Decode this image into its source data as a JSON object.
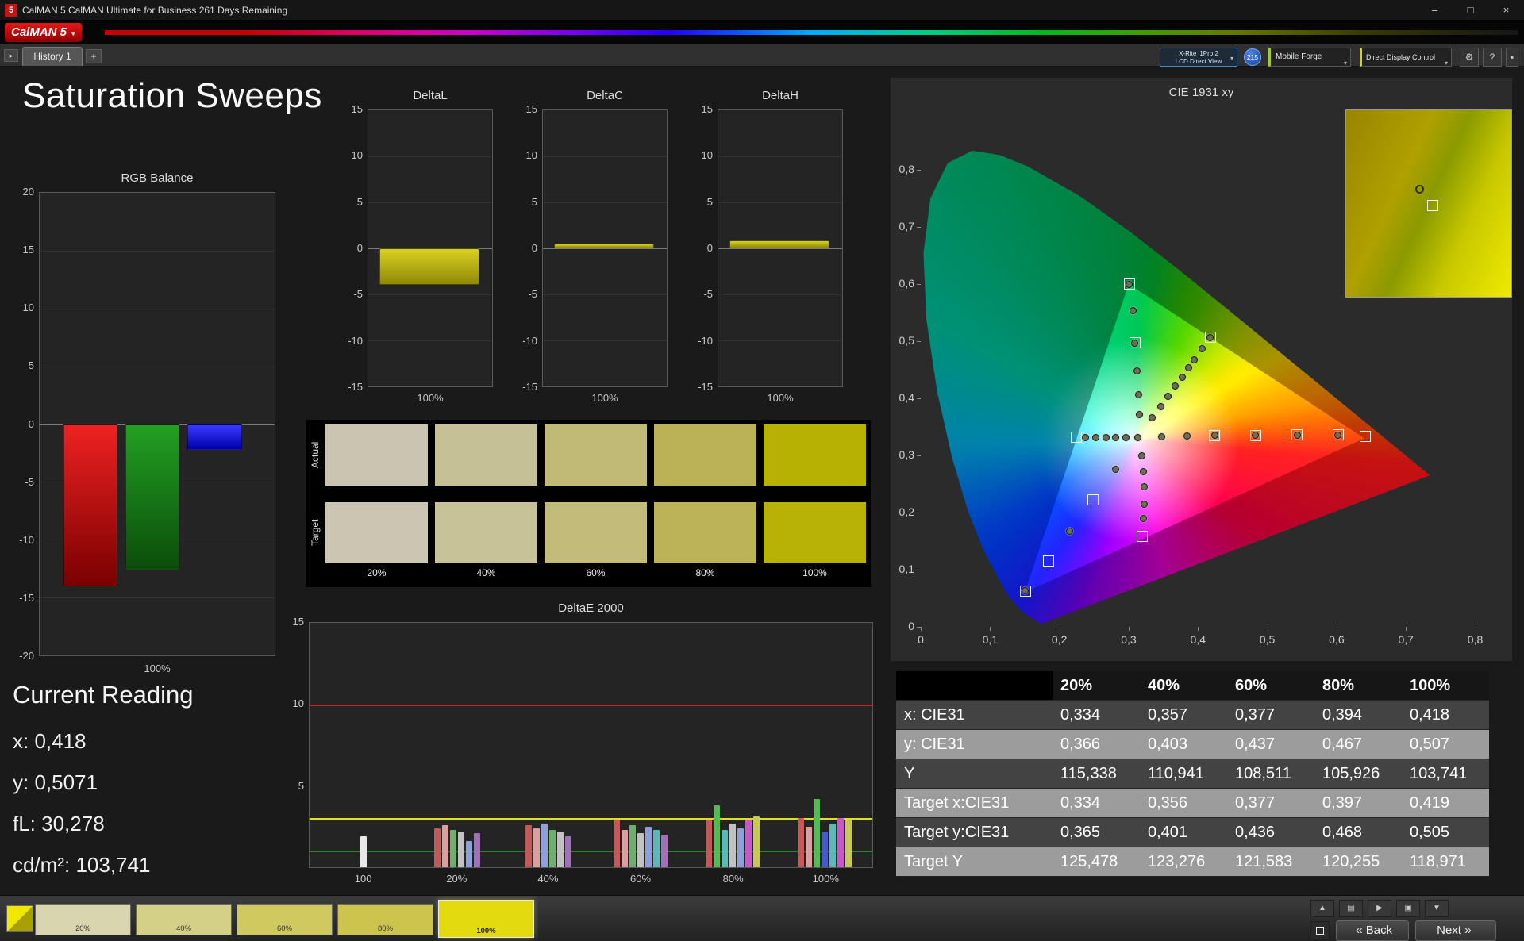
{
  "window": {
    "icon": "5",
    "title": "CalMAN 5 CalMAN Ultimate for Business 261 Days Remaining",
    "minimize": "–",
    "maximize": "□",
    "close": "×"
  },
  "icons": {
    "caret": "▾",
    "nav_arrow": "▸",
    "gear": "⚙",
    "help": "?",
    "pin": "▪",
    "chevron_left": "«",
    "chevron_right": "»"
  },
  "logo": {
    "text": "CalMAN 5"
  },
  "tabs": {
    "history": "History 1",
    "add": "+"
  },
  "meters": {
    "meter_line1": "X-Rite i1Pro 2",
    "meter_line2": "LCD Direct View",
    "badge": "215",
    "source": "Mobile Forge",
    "display_control": "Direct Display Control"
  },
  "page": {
    "title": "Saturation Sweeps"
  },
  "rgb_balance": {
    "title": "RGB Balance",
    "xlabel": "100%",
    "ylim": [
      -20,
      20
    ],
    "yticks": [
      "20",
      "15",
      "10",
      "5",
      "0",
      "-5",
      "-10",
      "-15",
      "-20"
    ],
    "bars": [
      {
        "name": "red",
        "value": -14.0,
        "c1": "#ee2222",
        "c2": "#7a0000"
      },
      {
        "name": "green",
        "value": -12.6,
        "c1": "#22a022",
        "c2": "#0b4d0b"
      },
      {
        "name": "blue",
        "value": -2.2,
        "c1": "#3a3aff",
        "c2": "#0000aa"
      }
    ]
  },
  "delta_axis": {
    "ylim": [
      -15,
      15
    ],
    "yticks": [
      "15",
      "10",
      "5",
      "0",
      "-5",
      "-10",
      "-15"
    ],
    "xlabel": "100%"
  },
  "delta_charts": [
    {
      "title": "DeltaL",
      "value": -4.0
    },
    {
      "title": "DeltaC",
      "value": 0.5
    },
    {
      "title": "DeltaH",
      "value": 0.9
    }
  ],
  "swatches": {
    "row_labels": [
      "Actual",
      "Target"
    ],
    "col_labels": [
      "20%",
      "40%",
      "60%",
      "80%",
      "100%"
    ],
    "actual": [
      "#c9c5b0",
      "#c6c195",
      "#c1ba77",
      "#bbb257",
      "#b7b104"
    ],
    "target": [
      "#cac6b1",
      "#c7c297",
      "#c2bb79",
      "#bcb359",
      "#b8b206"
    ]
  },
  "deltae": {
    "title": "DeltaE 2000",
    "ylim": [
      0,
      15
    ],
    "yticks": [
      "15",
      "10",
      "5"
    ],
    "ref_lines": [
      {
        "value": 10,
        "color": "#cc2222"
      },
      {
        "value": 3,
        "color": "#e0e020"
      },
      {
        "value": 1,
        "color": "#1e8c1e"
      }
    ],
    "groups": [
      {
        "label": "100",
        "x": 0.0965,
        "bars": [
          {
            "v": 1.9,
            "c": "#e8e8e8"
          }
        ]
      },
      {
        "label": "20%",
        "x": 0.262,
        "bars": [
          {
            "v": 2.4,
            "c": "#c25a5a"
          },
          {
            "v": 2.6,
            "c": "#daa0a0"
          },
          {
            "v": 2.3,
            "c": "#6fae6f"
          },
          {
            "v": 2.2,
            "c": "#c2c2c2"
          },
          {
            "v": 1.6,
            "c": "#8f9fd8"
          },
          {
            "v": 2.1,
            "c": "#a272b8"
          }
        ]
      },
      {
        "label": "40%",
        "x": 0.424,
        "bars": [
          {
            "v": 2.6,
            "c": "#c25a5a"
          },
          {
            "v": 2.4,
            "c": "#daa0a0"
          },
          {
            "v": 2.7,
            "c": "#8f9fd8"
          },
          {
            "v": 2.3,
            "c": "#6fae6f"
          },
          {
            "v": 2.2,
            "c": "#c2c2c2"
          },
          {
            "v": 1.9,
            "c": "#a272b8"
          }
        ]
      },
      {
        "label": "60%",
        "x": 0.588,
        "bars": [
          {
            "v": 2.9,
            "c": "#c25a5a"
          },
          {
            "v": 2.3,
            "c": "#daa0a0"
          },
          {
            "v": 2.6,
            "c": "#6fae6f"
          },
          {
            "v": 2.1,
            "c": "#c2c2c2"
          },
          {
            "v": 2.5,
            "c": "#8f9fd8"
          },
          {
            "v": 2.3,
            "c": "#5fb8b8"
          },
          {
            "v": 2.0,
            "c": "#a272b8"
          }
        ]
      },
      {
        "label": "80%",
        "x": 0.752,
        "bars": [
          {
            "v": 2.9,
            "c": "#c25a5a"
          },
          {
            "v": 3.8,
            "c": "#58b858"
          },
          {
            "v": 2.3,
            "c": "#5fb8b8"
          },
          {
            "v": 2.7,
            "c": "#c2c2c2"
          },
          {
            "v": 2.4,
            "c": "#8f9fd8"
          },
          {
            "v": 2.9,
            "c": "#c858c8"
          },
          {
            "v": 3.1,
            "c": "#c8c858"
          }
        ]
      },
      {
        "label": "100%",
        "x": 0.916,
        "bars": [
          {
            "v": 3.0,
            "c": "#c25a5a"
          },
          {
            "v": 2.5,
            "c": "#daa0a0"
          },
          {
            "v": 4.2,
            "c": "#58b858"
          },
          {
            "v": 2.2,
            "c": "#4858c8"
          },
          {
            "v": 2.7,
            "c": "#5fb8b8"
          },
          {
            "v": 3.0,
            "c": "#c858c8"
          },
          {
            "v": 2.9,
            "c": "#c8c858"
          }
        ]
      }
    ]
  },
  "current_reading": {
    "title": "Current Reading",
    "lines": [
      "x: 0,418",
      "y: 0,5071",
      "fL: 30,278",
      "cd/m²: 103,741"
    ]
  },
  "cie": {
    "title": "CIE 1931 xy",
    "xticks": [
      "0",
      "0,1",
      "0,2",
      "0,3",
      "0,4",
      "0,5",
      "0,6",
      "0,7",
      "0,8"
    ],
    "yticks": [
      "0,8",
      "0,7",
      "0,6",
      "0,5",
      "0,4",
      "0,3",
      "0,2",
      "0,1",
      "0"
    ],
    "markers": [
      {
        "x": 0.313,
        "y": 0.332,
        "s": "both"
      },
      {
        "x": 0.296,
        "y": 0.331,
        "s": "c"
      },
      {
        "x": 0.281,
        "y": 0.331,
        "s": "c"
      },
      {
        "x": 0.267,
        "y": 0.331,
        "s": "c"
      },
      {
        "x": 0.252,
        "y": 0.331,
        "s": "c"
      },
      {
        "x": 0.238,
        "y": 0.331,
        "s": "c"
      },
      {
        "x": 0.225,
        "y": 0.332,
        "s": "s"
      },
      {
        "x": 0.348,
        "y": 0.333,
        "s": "c"
      },
      {
        "x": 0.384,
        "y": 0.334,
        "s": "c"
      },
      {
        "x": 0.424,
        "y": 0.335,
        "s": "both"
      },
      {
        "x": 0.483,
        "y": 0.335,
        "s": "both"
      },
      {
        "x": 0.543,
        "y": 0.336,
        "s": "both"
      },
      {
        "x": 0.602,
        "y": 0.336,
        "s": "both"
      },
      {
        "x": 0.641,
        "y": 0.334,
        "s": "s"
      },
      {
        "x": 0.315,
        "y": 0.372,
        "s": "c"
      },
      {
        "x": 0.314,
        "y": 0.407,
        "s": "c"
      },
      {
        "x": 0.312,
        "y": 0.448,
        "s": "c"
      },
      {
        "x": 0.309,
        "y": 0.497,
        "s": "both"
      },
      {
        "x": 0.306,
        "y": 0.553,
        "s": "c"
      },
      {
        "x": 0.301,
        "y": 0.6,
        "s": "both"
      },
      {
        "x": 0.334,
        "y": 0.366,
        "s": "c"
      },
      {
        "x": 0.346,
        "y": 0.386,
        "s": "c"
      },
      {
        "x": 0.357,
        "y": 0.403,
        "s": "c"
      },
      {
        "x": 0.367,
        "y": 0.421,
        "s": "c"
      },
      {
        "x": 0.377,
        "y": 0.437,
        "s": "c"
      },
      {
        "x": 0.386,
        "y": 0.453,
        "s": "c"
      },
      {
        "x": 0.395,
        "y": 0.468,
        "s": "c"
      },
      {
        "x": 0.406,
        "y": 0.487,
        "s": "c"
      },
      {
        "x": 0.418,
        "y": 0.507,
        "s": "both"
      },
      {
        "x": 0.281,
        "y": 0.276,
        "s": "c"
      },
      {
        "x": 0.248,
        "y": 0.222,
        "s": "s"
      },
      {
        "x": 0.215,
        "y": 0.168,
        "s": "c"
      },
      {
        "x": 0.184,
        "y": 0.115,
        "s": "s"
      },
      {
        "x": 0.151,
        "y": 0.063,
        "s": "both"
      },
      {
        "x": 0.319,
        "y": 0.3,
        "s": "c"
      },
      {
        "x": 0.321,
        "y": 0.272,
        "s": "c"
      },
      {
        "x": 0.322,
        "y": 0.245,
        "s": "c"
      },
      {
        "x": 0.322,
        "y": 0.215,
        "s": "c"
      },
      {
        "x": 0.321,
        "y": 0.19,
        "s": "c"
      },
      {
        "x": 0.32,
        "y": 0.158,
        "s": "s"
      }
    ]
  },
  "table": {
    "columns": [
      "20%",
      "40%",
      "60%",
      "80%",
      "100%"
    ],
    "rows": [
      {
        "label": "x: CIE31",
        "shade": "dark",
        "values": [
          "0,334",
          "0,357",
          "0,377",
          "0,394",
          "0,418"
        ]
      },
      {
        "label": "y: CIE31",
        "shade": "light",
        "values": [
          "0,366",
          "0,403",
          "0,437",
          "0,467",
          "0,507"
        ]
      },
      {
        "label": "Y",
        "shade": "dark",
        "values": [
          "115,338",
          "110,941",
          "108,511",
          "105,926",
          "103,741"
        ]
      },
      {
        "label": "Target x:CIE31",
        "shade": "light",
        "values": [
          "0,334",
          "0,356",
          "0,377",
          "0,397",
          "0,419"
        ]
      },
      {
        "label": "Target y:CIE31",
        "shade": "dark",
        "values": [
          "0,365",
          "0,401",
          "0,436",
          "0,468",
          "0,505"
        ]
      },
      {
        "label": "Target Y",
        "shade": "light",
        "values": [
          "125,478",
          "123,276",
          "121,583",
          "120,255",
          "118,971"
        ]
      }
    ]
  },
  "footer": {
    "thumbnails": [
      {
        "label": "20%",
        "color": "#d9d5ae",
        "selected": false
      },
      {
        "label": "40%",
        "color": "#d5d088",
        "selected": false
      },
      {
        "label": "60%",
        "color": "#d0c95f",
        "selected": false
      },
      {
        "label": "80%",
        "color": "#cdc44e",
        "selected": false
      },
      {
        "label": "100%",
        "color": "#e4da10",
        "selected": true
      }
    ],
    "tools": [
      {
        "glyph": "▲",
        "name": "scroll-up-button"
      },
      {
        "glyph": "▤",
        "name": "pages-button"
      },
      {
        "glyph": "▶",
        "name": "play-button"
      },
      {
        "glyph": "▣",
        "name": "print-button"
      },
      {
        "glyph": "▼",
        "name": "scroll-down-button"
      }
    ],
    "back": "Back",
    "next": "Next"
  }
}
